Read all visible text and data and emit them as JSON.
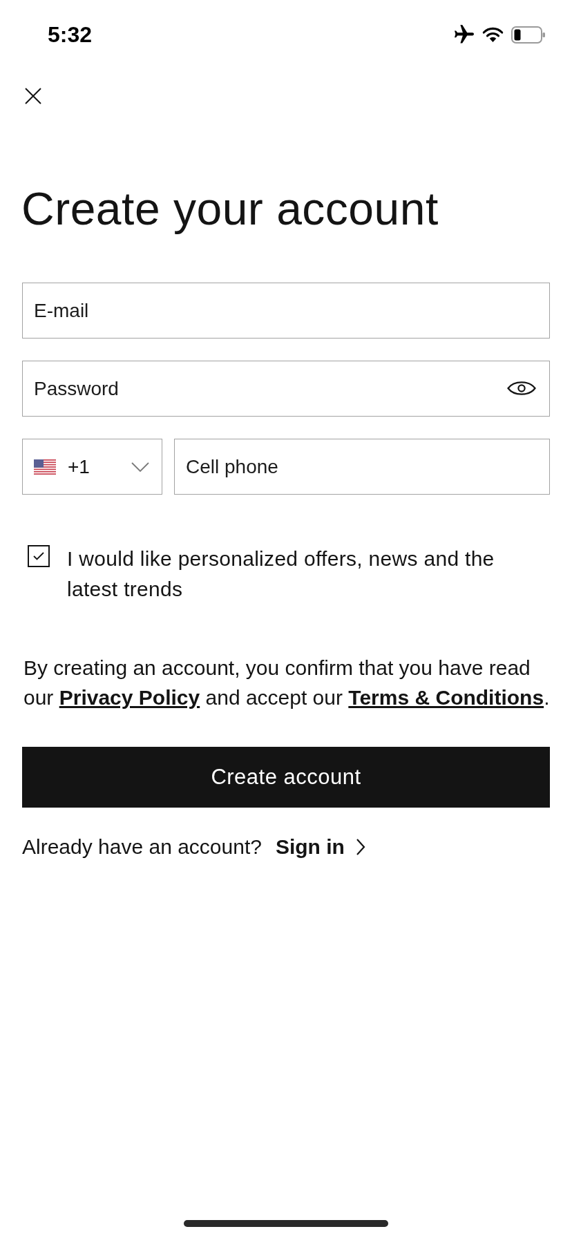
{
  "status_bar": {
    "time": "5:32"
  },
  "title": "Create your account",
  "fields": [
    {
      "kind": "email",
      "placeholder": "E-mail"
    },
    {
      "kind": "password",
      "placeholder": "Password"
    }
  ],
  "phone": {
    "country_code": "+1",
    "placeholder": "Cell phone"
  },
  "marketing_opt_in": {
    "label": "I would like personalized offers, news and the latest trends",
    "checked": true
  },
  "legal": {
    "text_before": "By creating an account, you confirm that you have read our",
    "privacy_link": "Privacy Policy",
    "text_middle": "and accept our",
    "terms_link": "Terms & Conditions",
    "text_after": "."
  },
  "create_button": "Create account",
  "sign_in": {
    "prompt": "Already have an account?",
    "link": "Sign in"
  }
}
